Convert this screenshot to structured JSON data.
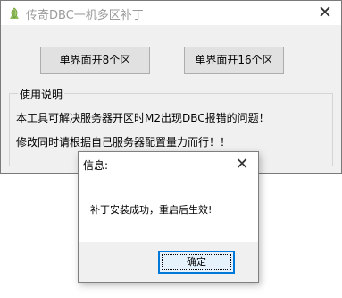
{
  "main_window": {
    "title": "传奇DBC一机多区补丁",
    "close_glyph": "✕",
    "buttons": {
      "btn_8": "单界面开8个区",
      "btn_16": "单界面开16个区"
    },
    "group": {
      "legend": "使用说明",
      "lines": [
        "本工具可解决服务器开区时M2出现DBC报错的问题！",
        "修改同时请根据自己服务器配置量力而行！！"
      ]
    }
  },
  "dialog": {
    "title": "信息:",
    "close_glyph": "✕",
    "message": "补丁安装成功，重启后生效!",
    "ok_label": "确定"
  },
  "colors": {
    "title_text": "#9a9a9a",
    "ok_border": "#0078d7",
    "window_bg": "#f0f0f0"
  },
  "icons": {
    "app": "leaf-app-icon",
    "close": "close-icon"
  }
}
